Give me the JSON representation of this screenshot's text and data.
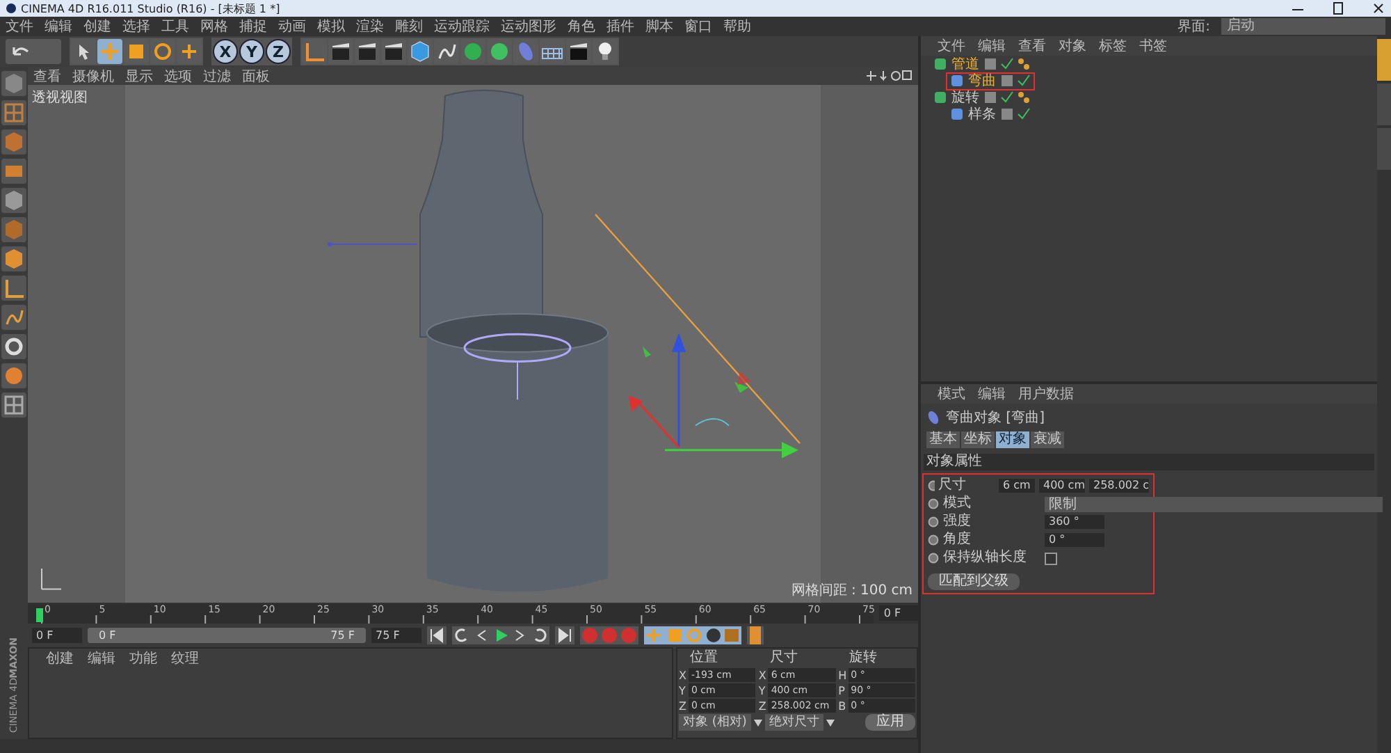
{
  "window": {
    "title": "CINEMA 4D R16.011 Studio (R16) - [未标题 1 *]"
  },
  "menu_bar": [
    "文件",
    "编辑",
    "创建",
    "选择",
    "工具",
    "网格",
    "捕捉",
    "动画",
    "模拟",
    "渲染",
    "雕刻",
    "运动跟踪",
    "运动图形",
    "角色",
    "插件",
    "脚本",
    "窗口",
    "帮助"
  ],
  "layout_field": {
    "label": "界面:",
    "value": "启动"
  },
  "axis_lock_buttons": [
    "X",
    "Y",
    "Z"
  ],
  "viewport": {
    "menu": [
      "查看",
      "摄像机",
      "显示",
      "选项",
      "过滤",
      "面板"
    ],
    "label": "透视视图",
    "grid_spacing": "网格间距 : 100 cm"
  },
  "object_manager": {
    "menu": [
      "文件",
      "编辑",
      "查看",
      "对象",
      "标签",
      "书签"
    ],
    "objects": [
      {
        "name": "管道",
        "selected": true,
        "outlined": false,
        "children": [
          {
            "name": "弯曲",
            "selected": true,
            "outlined": true
          }
        ]
      },
      {
        "name": "旋转",
        "selected": false,
        "outlined": false,
        "children": [
          {
            "name": "样条",
            "selected": false,
            "outlined": false
          }
        ]
      }
    ]
  },
  "attributes": {
    "menu": [
      "模式",
      "编辑",
      "用户数据"
    ],
    "object_title": "弯曲对象 [弯曲]",
    "tabs": [
      {
        "label": "基本",
        "selected": false
      },
      {
        "label": "坐标",
        "selected": false
      },
      {
        "label": "对象",
        "selected": true
      },
      {
        "label": "衰减",
        "selected": false
      }
    ],
    "section": "对象属性",
    "outlined": true,
    "rows": [
      {
        "kind": "vector",
        "label": "尺寸",
        "values": [
          "6 cm",
          "400 cm",
          "258.002 c"
        ]
      },
      {
        "kind": "dropdown",
        "label": "模式",
        "value": "限制"
      },
      {
        "kind": "number",
        "label": "强度",
        "value": "360 °"
      },
      {
        "kind": "number",
        "label": "角度",
        "value": "0 °"
      },
      {
        "kind": "checkbox",
        "label": "保持纵轴长度",
        "checked": false
      }
    ],
    "button": "匹配到父级"
  },
  "timeline": {
    "ticks": [
      "0",
      "5",
      "10",
      "15",
      "20",
      "25",
      "30",
      "35",
      "40",
      "45",
      "50",
      "55",
      "60",
      "65",
      "70",
      "75"
    ],
    "current_field": "0 F"
  },
  "playback": {
    "start": "0 F",
    "range_start": "0 F",
    "range_end": "75 F",
    "end": "75 F",
    "level": 1
  },
  "side_tabs": [
    {
      "selected": true
    },
    {
      "selected": false
    },
    {
      "selected": false
    }
  ],
  "materials": {
    "menu": [
      "创建",
      "编辑",
      "功能",
      "纹理"
    ]
  },
  "coordinates": {
    "headers": [
      "位置",
      "尺寸",
      "旋转"
    ],
    "rows": [
      [
        {
          "axis": "X",
          "value": "-193 cm"
        },
        {
          "axis": "X",
          "value": "6 cm"
        },
        {
          "axis": "H",
          "value": "0 °"
        }
      ],
      [
        {
          "axis": "Y",
          "value": "0 cm"
        },
        {
          "axis": "Y",
          "value": "400 cm"
        },
        {
          "axis": "P",
          "value": "90 °"
        }
      ],
      [
        {
          "axis": "Z",
          "value": "0 cm"
        },
        {
          "axis": "Z",
          "value": "258.002 cm"
        },
        {
          "axis": "B",
          "value": "0 °"
        }
      ]
    ],
    "mode": "对象 (相对)",
    "size_mode": "绝对尺寸",
    "apply": "应用"
  },
  "logo": {
    "brand": "MAXON",
    "product": "CINEMA 4D"
  }
}
